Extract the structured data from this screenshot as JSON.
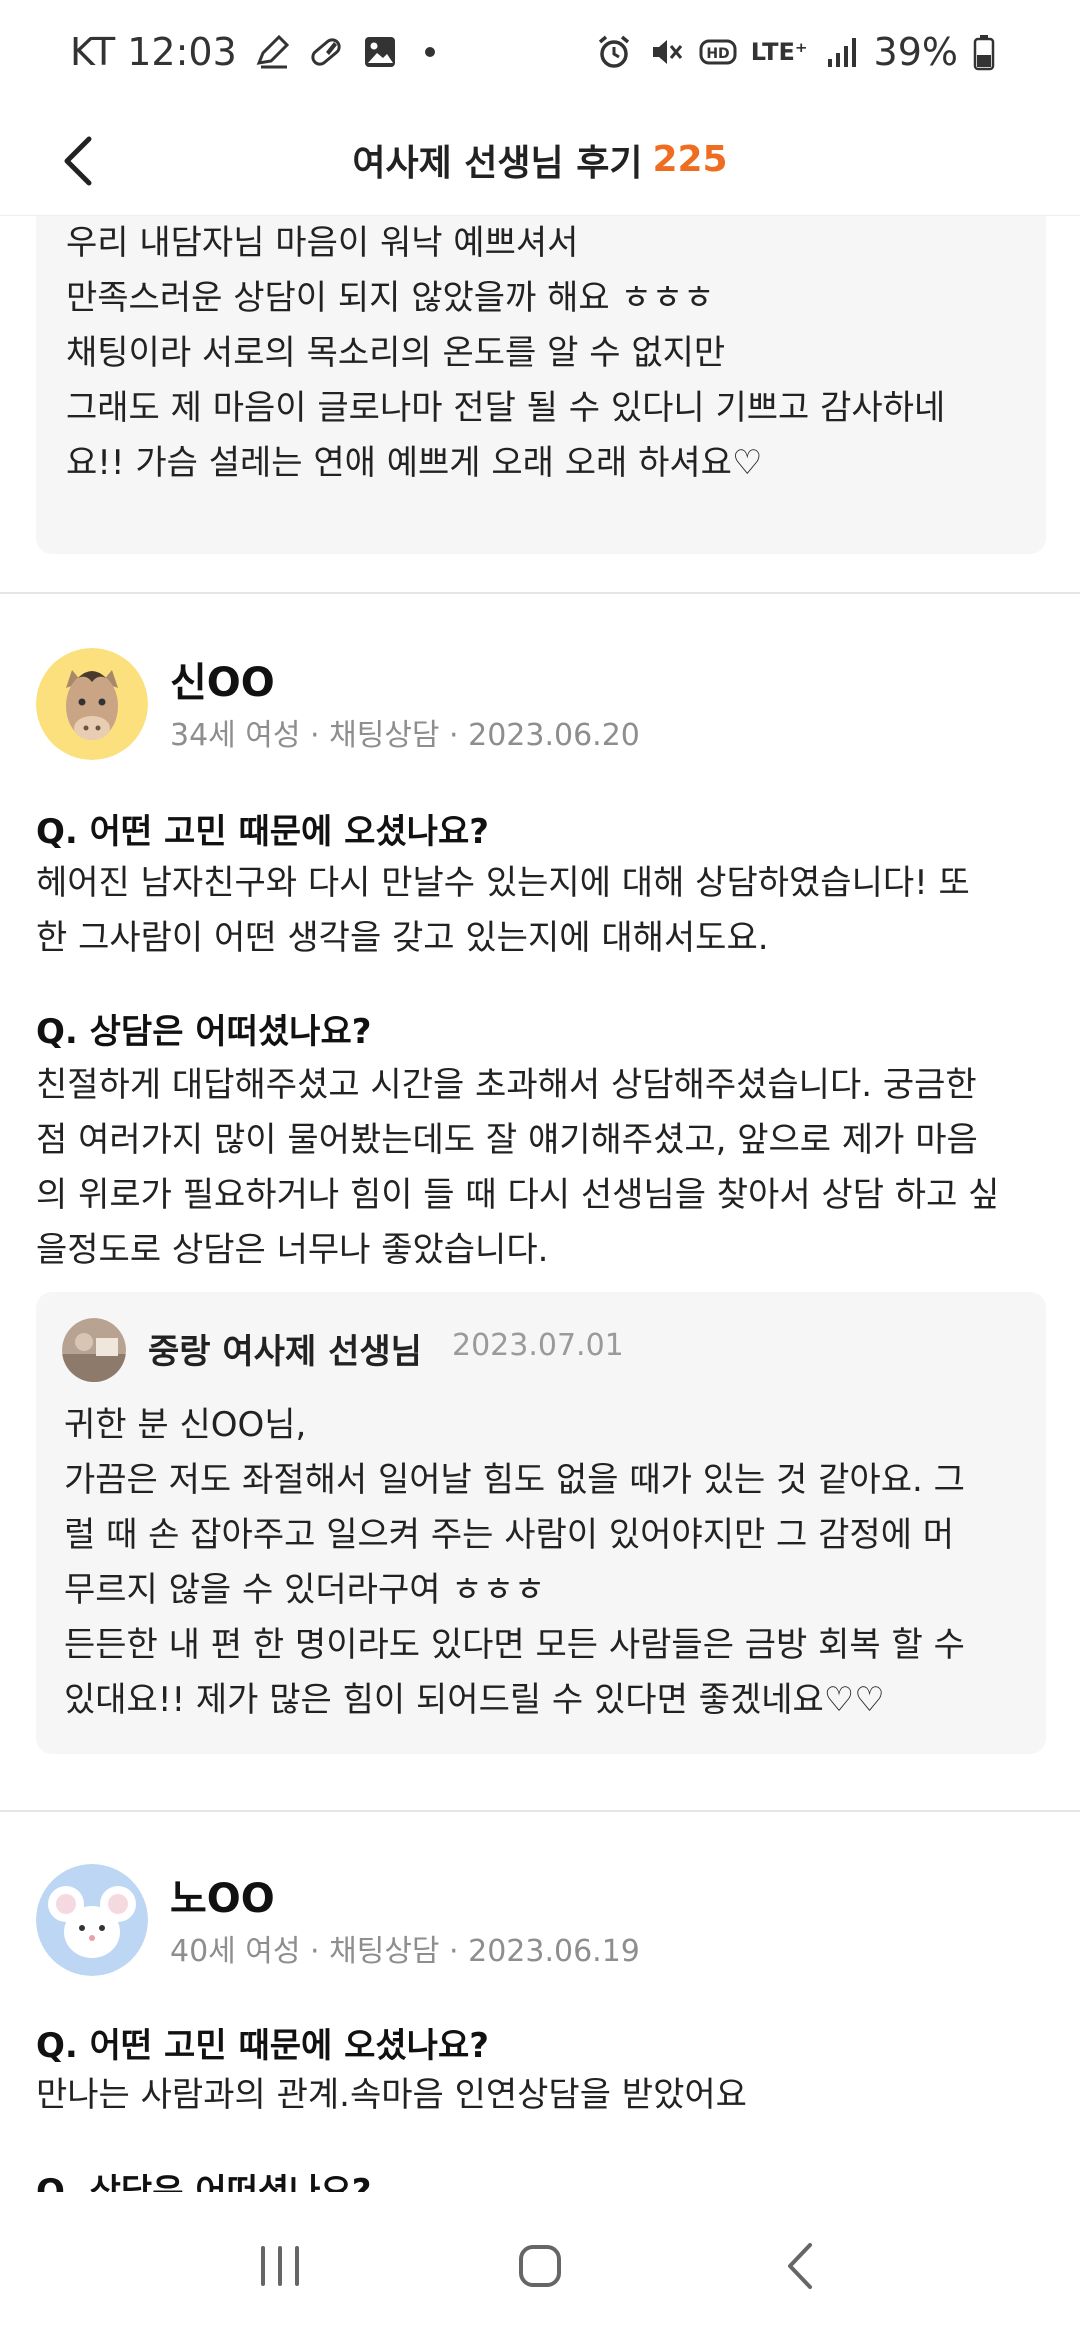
{
  "status_bar": {
    "carrier_time": "KT 12:03",
    "network": "LTE⁺",
    "battery": "39%",
    "icons": [
      "pen-icon",
      "pill-icon",
      "image-icon",
      "alarm-icon",
      "mute-icon",
      "hd-icon",
      "signal-icon",
      "battery-icon"
    ]
  },
  "header": {
    "title": "여사제 선생님 후기",
    "count": "225"
  },
  "top_reply": {
    "lines": [
      "우리 내담자님 마음이 워낙 예쁘셔서",
      "만족스러운 상담이 되지 않았을까 해요 ㅎㅎㅎ",
      "채팅이라 서로의 목소리의 온도를 알 수 없지만",
      "그래도 제 마음이 글로나마 전달 될 수 있다니 기쁘고 감사하네",
      "요!! 가슴 설레는 연애 예쁘게 오래 오래 하셔요♡"
    ]
  },
  "reviews": [
    {
      "name": "신OO",
      "meta": "34세 여성 · 채팅상담 · 2023.06.20",
      "q1": "Q. 어떤 고민 때문에 오셨나요?",
      "a1": [
        "헤어진 남자친구와 다시 만날수 있는지에 대해 상담하였습니다! 또",
        "한 그사람이 어떤 생각을 갖고 있는지에 대해서도요."
      ],
      "q2": "Q. 상담은 어떠셨나요?",
      "a2": [
        "친절하게 대답해주셨고 시간을 초과해서 상담해주셨습니다. 궁금한",
        "점 여러가지 많이 물어봤는데도 잘 얘기해주셨고, 앞으로 제가 마음",
        "의 위로가 필요하거나 힘이 들 때 다시 선생님을 찾아서 상담 하고 싶",
        "을정도로 상담은 너무나 좋았습니다."
      ],
      "reply": {
        "teacher": "중랑 여사제 선생님",
        "date": "2023.07.01",
        "lines": [
          "귀한 분 신OO님,",
          "가끔은 저도 좌절해서 일어날 힘도 없을 때가 있는 것 같아요. 그",
          "럴 때 손 잡아주고 일으켜 주는 사람이 있어야지만 그 감정에 머",
          "무르지 않을 수 있더라구여 ㅎㅎㅎ",
          "든든한 내 편 한 명이라도 있다면 모든 사람들은 금방 회복 할 수",
          "있대요!! 제가 많은 힘이 되어드릴 수 있다면 좋겠네요♡♡"
        ]
      }
    },
    {
      "name": "노OO",
      "meta": "40세 여성 · 채팅상담 · 2023.06.19",
      "q1": "Q. 어떤 고민 때문에 오셨나요?",
      "a1": [
        "만나는 사람과의 관계.속마음 인연상담을 받았어요"
      ],
      "q2": "Q. 상담은 어떠셨나요?"
    }
  ],
  "nav": {
    "icons": [
      "recent-apps-icon",
      "home-icon",
      "back-nav-icon"
    ]
  },
  "colors": {
    "accent": "#ef6d21",
    "reply_bg": "#f6f6f6",
    "meta_text": "#8e8e8e"
  }
}
